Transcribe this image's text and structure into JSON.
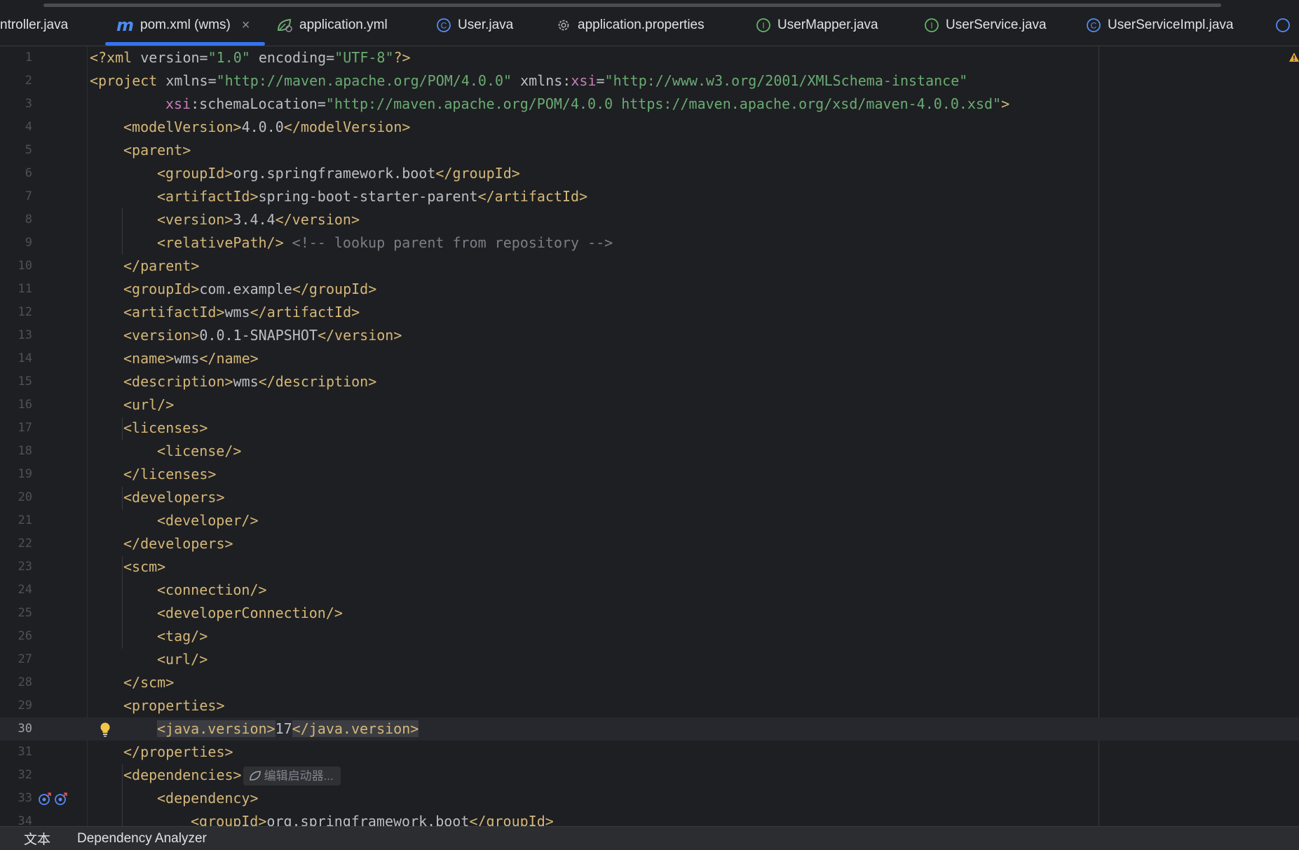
{
  "tabs": [
    {
      "label": "ntroller.java",
      "icon": "java-class-icon",
      "active": false
    },
    {
      "label": "pom.xml (wms)",
      "icon": "maven-icon",
      "icon_text": "m",
      "active": true
    },
    {
      "label": "application.yml",
      "icon": "spring-config-icon",
      "active": false
    },
    {
      "label": "User.java",
      "icon": "class-icon",
      "icon_text": "C",
      "active": false
    },
    {
      "label": "application.properties",
      "icon": "gear-icon",
      "active": false
    },
    {
      "label": "UserMapper.java",
      "icon": "interface-icon",
      "icon_text": "I",
      "active": false
    },
    {
      "label": "UserService.java",
      "icon": "interface-icon",
      "icon_text": "I",
      "active": false
    },
    {
      "label": "UserServiceImpl.java",
      "icon": "class-icon",
      "icon_text": "C",
      "active": false
    }
  ],
  "tab_close": "×",
  "editor": {
    "current_line": 30,
    "line_numbers": [
      "1",
      "2",
      "3",
      "4",
      "5",
      "6",
      "7",
      "8",
      "9",
      "10",
      "11",
      "12",
      "13",
      "14",
      "15",
      "16",
      "17",
      "18",
      "19",
      "20",
      "21",
      "22",
      "23",
      "24",
      "25",
      "26",
      "27",
      "28",
      "29",
      "30",
      "31",
      "32",
      "33",
      "34"
    ],
    "code": {
      "l1": {
        "decl_open": "<?xml ",
        "a1": "version=",
        "v1": "\"1.0\"",
        "a2": " encoding=",
        "v2": "\"UTF-8\"",
        "decl_close": "?>"
      },
      "l2": {
        "open": "<project ",
        "a1": "xmlns=",
        "v1": "\"http://maven.apache.org/POM/4.0.0\"",
        "a2": " xmlns:",
        "ns": "xsi",
        "eq": "=",
        "v2": "\"http://www.w3.org/2001/XMLSchema-instance\""
      },
      "l3": {
        "ns": "xsi",
        "a1": ":schemaLocation=",
        "v1": "\"http://maven.apache.org/POM/4.0.0 https://maven.apache.org/xsd/maven-4.0.0.xsd\"",
        "close": ">"
      },
      "l4": {
        "o": "<modelVersion>",
        "text": "4.0.0",
        "c": "</modelVersion>"
      },
      "l5": {
        "o": "<parent>"
      },
      "l6": {
        "o": "<groupId>",
        "text": "org.springframework.boot",
        "c": "</groupId>"
      },
      "l7": {
        "o": "<artifactId>",
        "text": "spring-boot-starter-parent",
        "c": "</artifactId>"
      },
      "l8": {
        "o": "<version>",
        "text": "3.4.4",
        "c": "</version>"
      },
      "l9": {
        "o": "<relativePath/>",
        "comment": " <!-- lookup parent from repository -->"
      },
      "l10": {
        "o": "</parent>"
      },
      "l11": {
        "o": "<groupId>",
        "text": "com.example",
        "c": "</groupId>"
      },
      "l12": {
        "o": "<artifactId>",
        "text": "wms",
        "c": "</artifactId>"
      },
      "l13": {
        "o": "<version>",
        "text": "0.0.1-SNAPSHOT",
        "c": "</version>"
      },
      "l14": {
        "o": "<name>",
        "text": "wms",
        "c": "</name>"
      },
      "l15": {
        "o": "<description>",
        "text": "wms",
        "c": "</description>"
      },
      "l16": {
        "o": "<url/>"
      },
      "l17": {
        "o": "<licenses>"
      },
      "l18": {
        "o": "<license/>"
      },
      "l19": {
        "o": "</licenses>"
      },
      "l20": {
        "o": "<developers>"
      },
      "l21": {
        "o": "<developer/>"
      },
      "l22": {
        "o": "</developers>"
      },
      "l23": {
        "o": "<scm>"
      },
      "l24": {
        "o": "<connection/>"
      },
      "l25": {
        "o": "<developerConnection/>"
      },
      "l26": {
        "o": "<tag/>"
      },
      "l27": {
        "o": "<url/>"
      },
      "l28": {
        "o": "</scm>"
      },
      "l29": {
        "o": "<properties>"
      },
      "l30": {
        "o": "<java.version>",
        "text": "17",
        "c": "</java.version>"
      },
      "l31": {
        "o": "</properties>"
      },
      "l32": {
        "o": "<dependencies>",
        "hint": "编辑启动器..."
      },
      "l33": {
        "o": "<dependency>"
      },
      "l34": {
        "o": "<groupId>",
        "text": "org.springframework.boot",
        "c": "</groupId>"
      }
    }
  },
  "bottom_tabs": [
    "文本",
    "Dependency Analyzer"
  ],
  "colors": {
    "background": "#1e1f22",
    "tag": "#d5b778",
    "string": "#6aab73",
    "namespace": "#c77dbb",
    "comment": "#7a7e85",
    "accent": "#3574f0"
  }
}
